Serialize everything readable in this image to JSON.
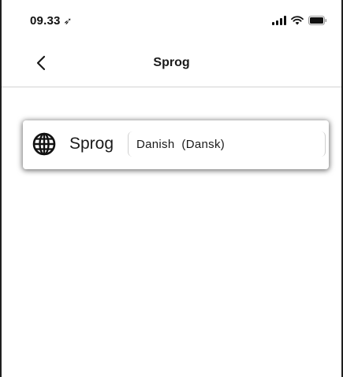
{
  "status_bar": {
    "time": "09.33",
    "location_icon": "location-arrow-icon",
    "icons": [
      "signal-icon",
      "wifi-icon",
      "battery-icon"
    ]
  },
  "nav": {
    "back_icon": "chevron-left-icon",
    "title": "Sprog"
  },
  "language_setting": {
    "icon": "globe-icon",
    "label": "Sprog",
    "selected_value": "Danish  (Dansk)"
  }
}
